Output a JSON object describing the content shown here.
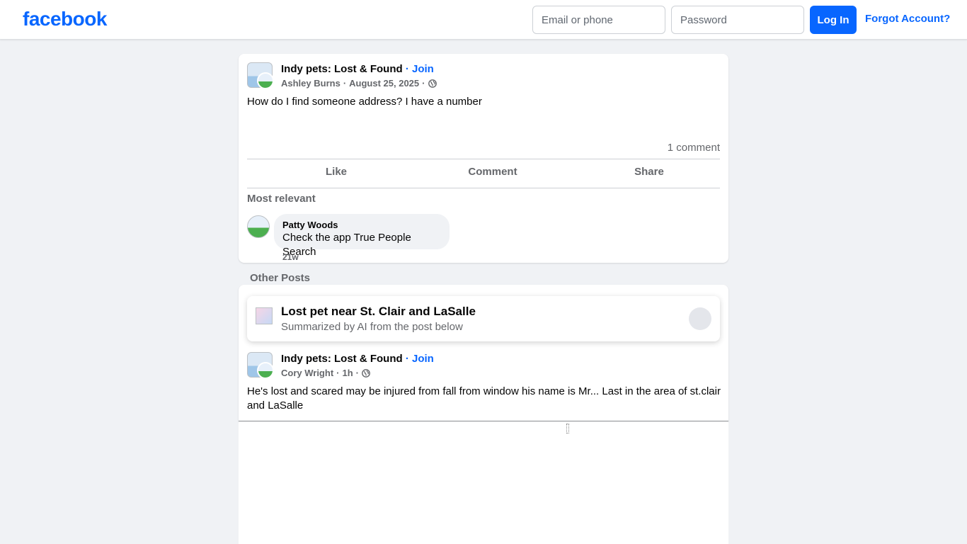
{
  "header": {
    "logo": "facebook",
    "email_placeholder": "Email or phone",
    "password_placeholder": "Password",
    "login_label": "Log In",
    "forgot_label": "Forgot Account?"
  },
  "post1": {
    "group_name": "Indy pets: Lost & Found",
    "separator": " · ",
    "join_label": "Join",
    "author": "Ashley Burns",
    "date": "August 25, 2025",
    "text": "How do I find someone address? I have a number",
    "comment_count": "1 comment",
    "actions": {
      "like": "Like",
      "comment": "Comment",
      "share": "Share"
    },
    "most_relevant": "Most relevant",
    "comment": {
      "author": "Patty Woods",
      "text": "Check the app True People Search",
      "time": "21w"
    }
  },
  "other_posts_label": "Other Posts",
  "ai_summary": {
    "title": "Lost pet near St. Clair and LaSalle",
    "subtitle": "Summarized by AI from the post below"
  },
  "post2": {
    "group_name": "Indy pets: Lost & Found",
    "separator": " · ",
    "join_label": "Join",
    "author": "Cory Wright",
    "time": "1h",
    "text": "He's lost and scared may be injured from fall from window his name is Mr... Last in the area of st.clair and LaSalle"
  },
  "icons": {
    "privacy": "globe-icon",
    "group_avatar": "group-avatar-icon",
    "ai": "ai-summary-icon"
  }
}
